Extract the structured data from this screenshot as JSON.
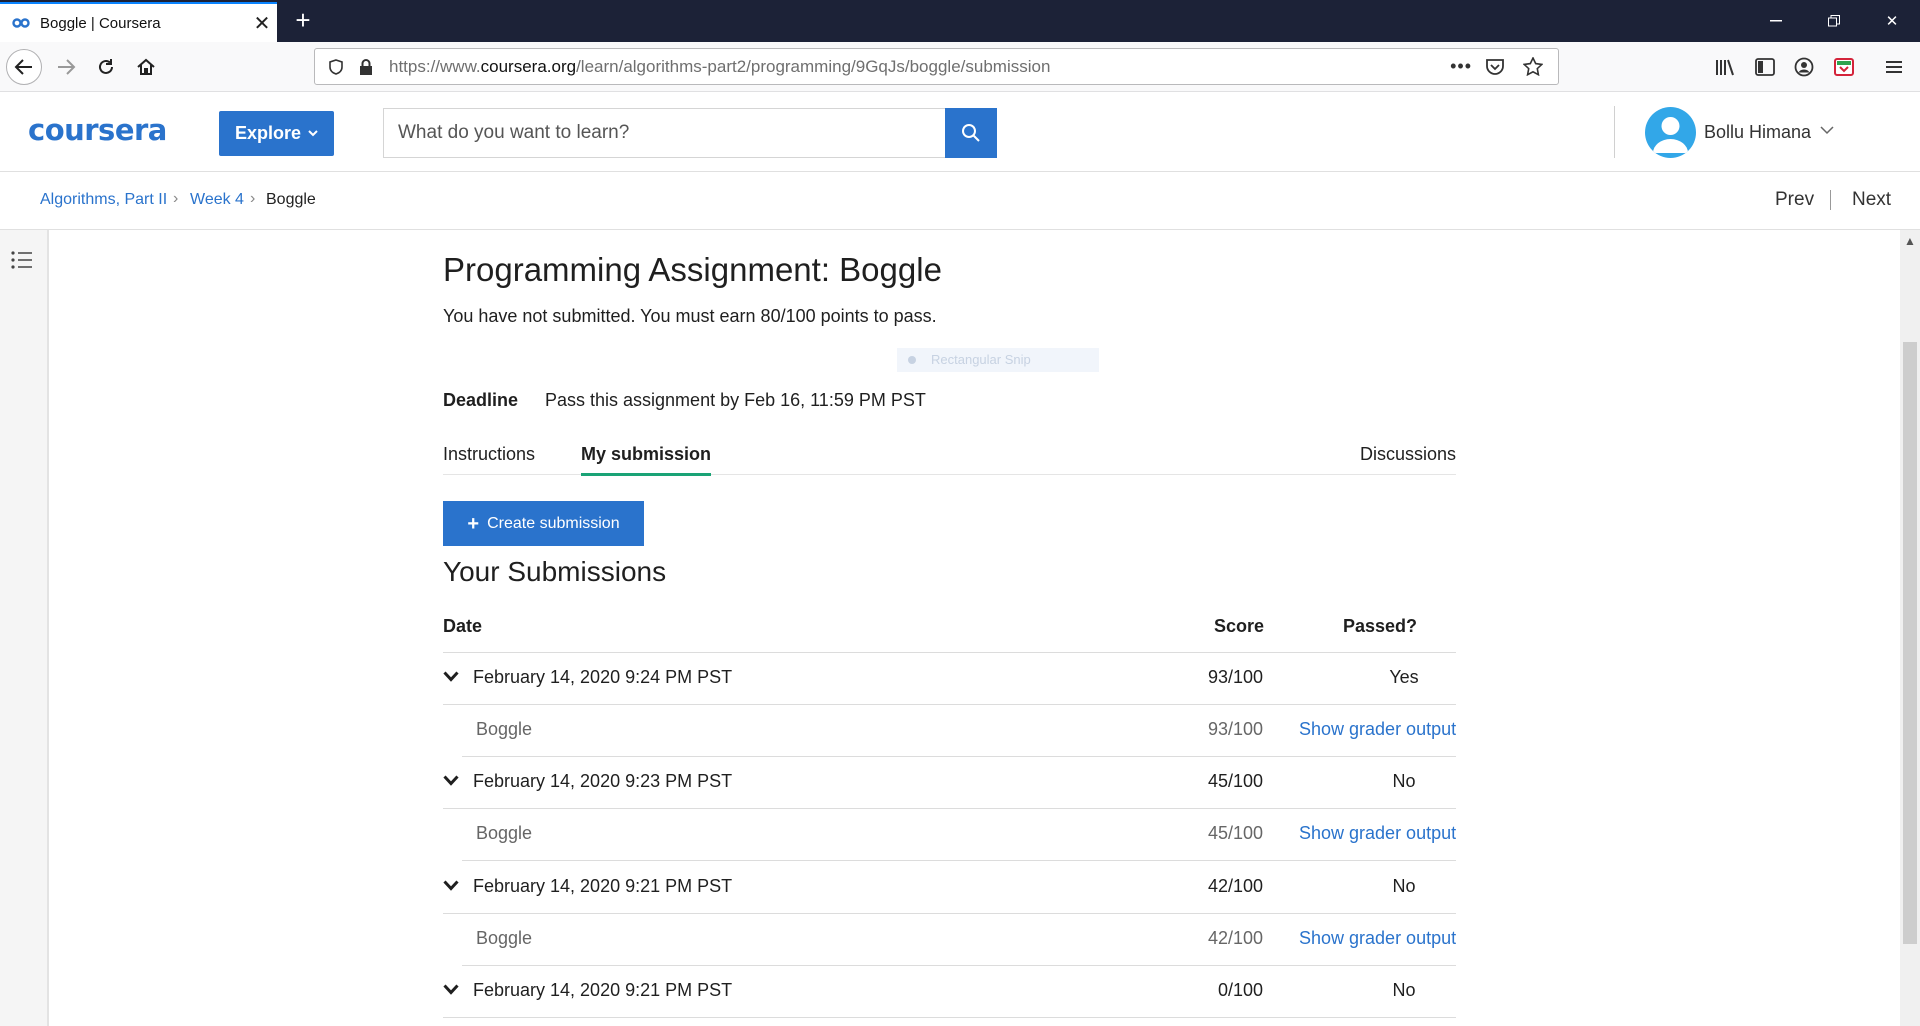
{
  "browser": {
    "tab_title": "Boggle | Coursera",
    "url_prefix": "https://www.",
    "url_domain": "coursera.org",
    "url_path": "/learn/algorithms-part2/programming/9GqJs/boggle/submission"
  },
  "header": {
    "logo": "coursera",
    "explore_label": "Explore",
    "search_placeholder": "What do you want to learn?",
    "user_name": "Bollu Himana"
  },
  "breadcrumb": {
    "items": [
      "Algorithms, Part II",
      "Week 4",
      "Boggle"
    ],
    "prev": "Prev",
    "next": "Next"
  },
  "snip_overlay": "Rectangular Snip",
  "assignment": {
    "title": "Programming Assignment: Boggle",
    "status": "You have not submitted. You must earn 80/100 points to pass.",
    "deadline_label": "Deadline",
    "deadline_text": "Pass this assignment by Feb 16, 11:59 PM PST"
  },
  "tabs": {
    "instructions": "Instructions",
    "my_submission": "My submission",
    "discussions": "Discussions"
  },
  "create_submission_label": "Create submission",
  "submissions": {
    "heading": "Your Submissions",
    "columns": {
      "date": "Date",
      "score": "Score",
      "passed": "Passed?"
    },
    "rows": [
      {
        "date": "February 14, 2020 9:24 PM PST",
        "score": "93/100",
        "passed": "Yes",
        "part": "Boggle",
        "part_score": "93/100",
        "link": "Show grader output"
      },
      {
        "date": "February 14, 2020 9:23 PM PST",
        "score": "45/100",
        "passed": "No",
        "part": "Boggle",
        "part_score": "45/100",
        "link": "Show grader output"
      },
      {
        "date": "February 14, 2020 9:21 PM PST",
        "score": "42/100",
        "passed": "No",
        "part": "Boggle",
        "part_score": "42/100",
        "link": "Show grader output"
      },
      {
        "date": "February 14, 2020 9:21 PM PST",
        "score": "0/100",
        "passed": "No"
      }
    ]
  },
  "colors": {
    "brand": "#2a73cc",
    "active_tab": "#1aa376",
    "tabbar": "#1c2237"
  }
}
